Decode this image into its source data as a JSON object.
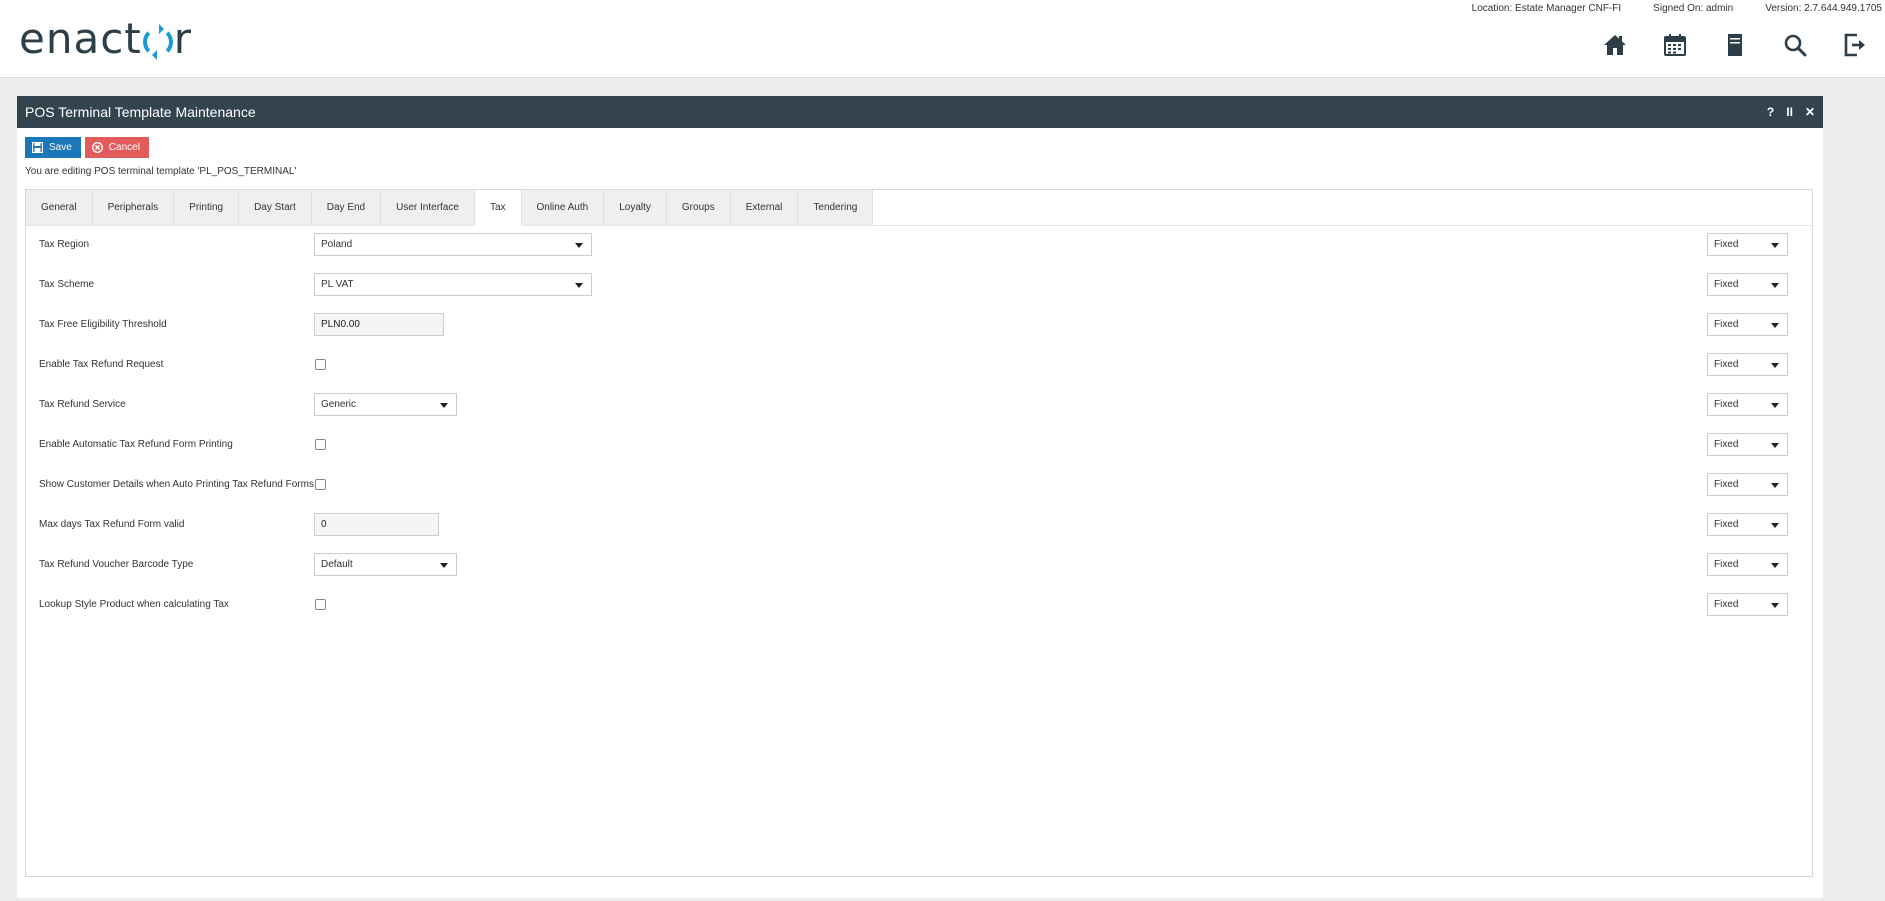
{
  "header": {
    "logo_pre": "enact",
    "logo_post": "r",
    "location": "Location: Estate Manager CNF-FI",
    "signed_on": "Signed On: admin",
    "version": "Version: 2.7.644.949.1705",
    "nav_icons": [
      "home-icon",
      "calendar-icon",
      "document-icon",
      "search-icon",
      "logout-icon"
    ]
  },
  "panel": {
    "title": "POS Terminal Template Maintenance",
    "controls": {
      "help": "?",
      "pause": "II",
      "close": "✕"
    },
    "save_label": "Save",
    "cancel_label": "Cancel",
    "editing_text": "You are editing POS terminal template 'PL_POS_TERMINAL'"
  },
  "tabs": [
    "General",
    "Peripherals",
    "Printing",
    "Day Start",
    "Day End",
    "User Interface",
    "Tax",
    "Online Auth",
    "Loyalty",
    "Groups",
    "External",
    "Tendering"
  ],
  "active_tab": "Tax",
  "fields": [
    {
      "label": "Tax Region",
      "type": "select",
      "value": "Poland",
      "mode": "Fixed"
    },
    {
      "label": "Tax Scheme",
      "type": "select",
      "value": "PL VAT",
      "mode": "Fixed"
    },
    {
      "label": "Tax Free Eligibility Threshold",
      "type": "text",
      "value": "PLN0.00",
      "mode": "Fixed"
    },
    {
      "label": "Enable Tax Refund Request",
      "type": "checkbox",
      "value": false,
      "mode": "Fixed"
    },
    {
      "label": "Tax Refund Service",
      "type": "select",
      "value": "Generic",
      "mode": "Fixed"
    },
    {
      "label": "Enable Automatic Tax Refund Form Printing",
      "type": "checkbox",
      "value": false,
      "mode": "Fixed"
    },
    {
      "label": "Show Customer Details when Auto Printing Tax Refund Forms",
      "type": "checkbox",
      "value": false,
      "mode": "Fixed"
    },
    {
      "label": "Max days Tax Refund Form valid",
      "type": "text",
      "value": "0",
      "mode": "Fixed"
    },
    {
      "label": "Tax Refund Voucher Barcode Type",
      "type": "select",
      "value": "Default",
      "mode": "Fixed"
    },
    {
      "label": "Lookup Style Product when calculating Tax",
      "type": "checkbox",
      "value": false,
      "mode": "Fixed"
    }
  ]
}
